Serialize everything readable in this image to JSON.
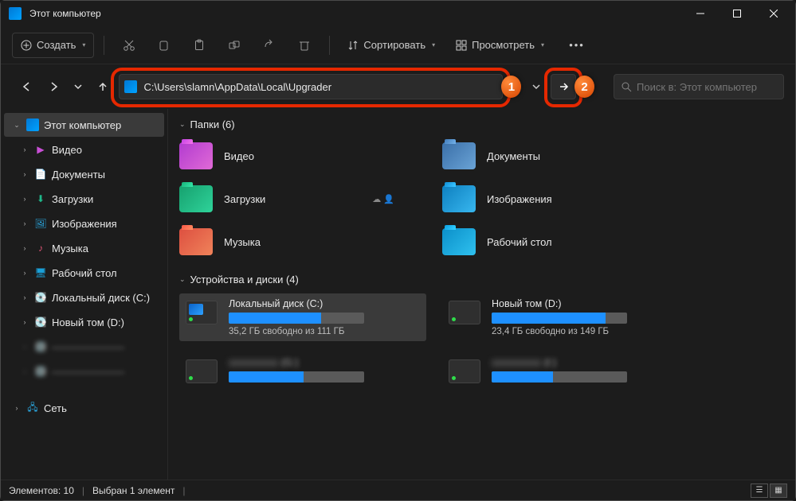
{
  "window": {
    "title": "Этот компьютер"
  },
  "toolbar": {
    "new_label": "Создать",
    "sort_label": "Сортировать",
    "view_label": "Просмотреть"
  },
  "address": {
    "path": "C:\\Users\\slamn\\AppData\\Local\\Upgrader"
  },
  "search": {
    "placeholder": "Поиск в: Этот компьютер"
  },
  "annotations": {
    "badge1": "1",
    "badge2": "2"
  },
  "sidebar": {
    "root": "Этот компьютер",
    "items": [
      {
        "label": "Видео",
        "color": "#c94fd6",
        "emoji": "▶"
      },
      {
        "label": "Документы",
        "color": "#3b82c7",
        "emoji": "📄"
      },
      {
        "label": "Загрузки",
        "color": "#1fb88a",
        "emoji": "⬇"
      },
      {
        "label": "Изображения",
        "color": "#2aa7e0",
        "emoji": "🖼"
      },
      {
        "label": "Музыка",
        "color": "#e05577",
        "emoji": "♪"
      },
      {
        "label": "Рабочий стол",
        "color": "#1aa0d8",
        "emoji": "🖥"
      },
      {
        "label": "Локальный диск (C:)",
        "color": "#888",
        "emoji": "💽"
      },
      {
        "label": "Новый том (D:)",
        "color": "#888",
        "emoji": "💽"
      }
    ],
    "network": "Сеть"
  },
  "groups": {
    "folders_header": "Папки (6)",
    "drives_header": "Устройства и диски (4)"
  },
  "folders": [
    {
      "label": "Видео",
      "bg": "linear-gradient(135deg,#b23bd0,#e06ad6)"
    },
    {
      "label": "Документы",
      "bg": "linear-gradient(135deg,#3a6fa8,#6aa3d6)"
    },
    {
      "label": "Загрузки",
      "bg": "linear-gradient(135deg,#16a06e,#2fd39a)"
    },
    {
      "label": "Изображения",
      "bg": "linear-gradient(135deg,#0d7fbf,#38b7ef)"
    },
    {
      "label": "Музыка",
      "bg": "linear-gradient(135deg,#dd4f40,#f0835a)"
    },
    {
      "label": "Рабочий стол",
      "bg": "linear-gradient(135deg,#0b8fc9,#2fc1ef)"
    }
  ],
  "drives": [
    {
      "name": "Локальный диск (C:)",
      "free": "35,2 ГБ свободно из 111 ГБ",
      "fill": 68,
      "os": true,
      "selected": true
    },
    {
      "name": "Новый том (D:)",
      "free": "23,4 ГБ свободно из 149 ГБ",
      "fill": 84,
      "os": false,
      "selected": false
    },
    {
      "name": "(G:)",
      "free": "",
      "fill": 55,
      "os": false,
      "selected": false,
      "blur": true
    },
    {
      "name": "(I:)",
      "free": "",
      "fill": 45,
      "os": false,
      "selected": false,
      "blur": true
    }
  ],
  "status": {
    "count": "Элементов: 10",
    "selection": "Выбран 1 элемент"
  }
}
